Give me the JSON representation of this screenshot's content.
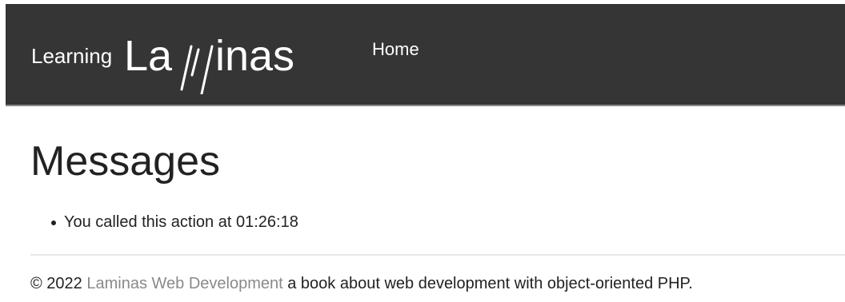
{
  "header": {
    "brand_prefix": "Learning",
    "brand_logo_text": "Laminas",
    "nav_home": "Home"
  },
  "main": {
    "title": "Messages",
    "messages": [
      "You called this action at 01:26:18"
    ]
  },
  "footer": {
    "prefix": "© 2022",
    "link_text": "Laminas Web Development",
    "suffix": "a book about web development with object-oriented PHP."
  },
  "colors": {
    "header_bg": "#353535",
    "header_text": "#ffffff",
    "link_muted": "#8a8a8a",
    "divider": "#e7e7e7"
  }
}
